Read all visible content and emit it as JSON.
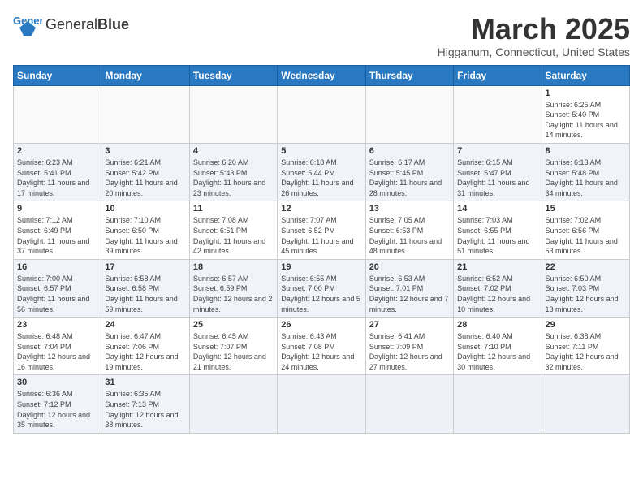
{
  "header": {
    "logo_text_normal": "General",
    "logo_text_bold": "Blue",
    "month_title": "March 2025",
    "location": "Higganum, Connecticut, United States"
  },
  "weekdays": [
    "Sunday",
    "Monday",
    "Tuesday",
    "Wednesday",
    "Thursday",
    "Friday",
    "Saturday"
  ],
  "weeks": [
    [
      {
        "day": "",
        "info": ""
      },
      {
        "day": "",
        "info": ""
      },
      {
        "day": "",
        "info": ""
      },
      {
        "day": "",
        "info": ""
      },
      {
        "day": "",
        "info": ""
      },
      {
        "day": "",
        "info": ""
      },
      {
        "day": "1",
        "info": "Sunrise: 6:25 AM\nSunset: 5:40 PM\nDaylight: 11 hours\nand 14 minutes."
      }
    ],
    [
      {
        "day": "2",
        "info": "Sunrise: 6:23 AM\nSunset: 5:41 PM\nDaylight: 11 hours\nand 17 minutes."
      },
      {
        "day": "3",
        "info": "Sunrise: 6:21 AM\nSunset: 5:42 PM\nDaylight: 11 hours\nand 20 minutes."
      },
      {
        "day": "4",
        "info": "Sunrise: 6:20 AM\nSunset: 5:43 PM\nDaylight: 11 hours\nand 23 minutes."
      },
      {
        "day": "5",
        "info": "Sunrise: 6:18 AM\nSunset: 5:44 PM\nDaylight: 11 hours\nand 26 minutes."
      },
      {
        "day": "6",
        "info": "Sunrise: 6:17 AM\nSunset: 5:45 PM\nDaylight: 11 hours\nand 28 minutes."
      },
      {
        "day": "7",
        "info": "Sunrise: 6:15 AM\nSunset: 5:47 PM\nDaylight: 11 hours\nand 31 minutes."
      },
      {
        "day": "8",
        "info": "Sunrise: 6:13 AM\nSunset: 5:48 PM\nDaylight: 11 hours\nand 34 minutes."
      }
    ],
    [
      {
        "day": "9",
        "info": "Sunrise: 7:12 AM\nSunset: 6:49 PM\nDaylight: 11 hours\nand 37 minutes."
      },
      {
        "day": "10",
        "info": "Sunrise: 7:10 AM\nSunset: 6:50 PM\nDaylight: 11 hours\nand 39 minutes."
      },
      {
        "day": "11",
        "info": "Sunrise: 7:08 AM\nSunset: 6:51 PM\nDaylight: 11 hours\nand 42 minutes."
      },
      {
        "day": "12",
        "info": "Sunrise: 7:07 AM\nSunset: 6:52 PM\nDaylight: 11 hours\nand 45 minutes."
      },
      {
        "day": "13",
        "info": "Sunrise: 7:05 AM\nSunset: 6:53 PM\nDaylight: 11 hours\nand 48 minutes."
      },
      {
        "day": "14",
        "info": "Sunrise: 7:03 AM\nSunset: 6:55 PM\nDaylight: 11 hours\nand 51 minutes."
      },
      {
        "day": "15",
        "info": "Sunrise: 7:02 AM\nSunset: 6:56 PM\nDaylight: 11 hours\nand 53 minutes."
      }
    ],
    [
      {
        "day": "16",
        "info": "Sunrise: 7:00 AM\nSunset: 6:57 PM\nDaylight: 11 hours\nand 56 minutes."
      },
      {
        "day": "17",
        "info": "Sunrise: 6:58 AM\nSunset: 6:58 PM\nDaylight: 11 hours\nand 59 minutes."
      },
      {
        "day": "18",
        "info": "Sunrise: 6:57 AM\nSunset: 6:59 PM\nDaylight: 12 hours\nand 2 minutes."
      },
      {
        "day": "19",
        "info": "Sunrise: 6:55 AM\nSunset: 7:00 PM\nDaylight: 12 hours\nand 5 minutes."
      },
      {
        "day": "20",
        "info": "Sunrise: 6:53 AM\nSunset: 7:01 PM\nDaylight: 12 hours\nand 7 minutes."
      },
      {
        "day": "21",
        "info": "Sunrise: 6:52 AM\nSunset: 7:02 PM\nDaylight: 12 hours\nand 10 minutes."
      },
      {
        "day": "22",
        "info": "Sunrise: 6:50 AM\nSunset: 7:03 PM\nDaylight: 12 hours\nand 13 minutes."
      }
    ],
    [
      {
        "day": "23",
        "info": "Sunrise: 6:48 AM\nSunset: 7:04 PM\nDaylight: 12 hours\nand 16 minutes."
      },
      {
        "day": "24",
        "info": "Sunrise: 6:47 AM\nSunset: 7:06 PM\nDaylight: 12 hours\nand 19 minutes."
      },
      {
        "day": "25",
        "info": "Sunrise: 6:45 AM\nSunset: 7:07 PM\nDaylight: 12 hours\nand 21 minutes."
      },
      {
        "day": "26",
        "info": "Sunrise: 6:43 AM\nSunset: 7:08 PM\nDaylight: 12 hours\nand 24 minutes."
      },
      {
        "day": "27",
        "info": "Sunrise: 6:41 AM\nSunset: 7:09 PM\nDaylight: 12 hours\nand 27 minutes."
      },
      {
        "day": "28",
        "info": "Sunrise: 6:40 AM\nSunset: 7:10 PM\nDaylight: 12 hours\nand 30 minutes."
      },
      {
        "day": "29",
        "info": "Sunrise: 6:38 AM\nSunset: 7:11 PM\nDaylight: 12 hours\nand 32 minutes."
      }
    ],
    [
      {
        "day": "30",
        "info": "Sunrise: 6:36 AM\nSunset: 7:12 PM\nDaylight: 12 hours\nand 35 minutes."
      },
      {
        "day": "31",
        "info": "Sunrise: 6:35 AM\nSunset: 7:13 PM\nDaylight: 12 hours\nand 38 minutes."
      },
      {
        "day": "",
        "info": ""
      },
      {
        "day": "",
        "info": ""
      },
      {
        "day": "",
        "info": ""
      },
      {
        "day": "",
        "info": ""
      },
      {
        "day": "",
        "info": ""
      }
    ]
  ]
}
